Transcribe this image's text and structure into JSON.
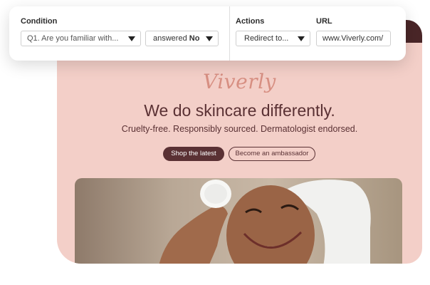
{
  "rule": {
    "condition_label": "Condition",
    "question_value": "Q1. Are you familiar with...",
    "answer_prefix": "answered",
    "answer_value": "No",
    "actions_label": "Actions",
    "action_value": "Redirect to...",
    "url_label": "URL",
    "url_value": "www.Viverly.com/"
  },
  "site": {
    "logo": "Viverly",
    "headline": "We do skincare differently.",
    "subline": "Cruelty-free. Responsibly sourced. Dermatologist endorsed.",
    "primary_button": "Shop the latest",
    "secondary_button": "Become an ambassador"
  },
  "colors": {
    "brand_dark": "#5a3134",
    "brand_pink": "#f3cfc8",
    "logo_color": "#d78f82"
  }
}
